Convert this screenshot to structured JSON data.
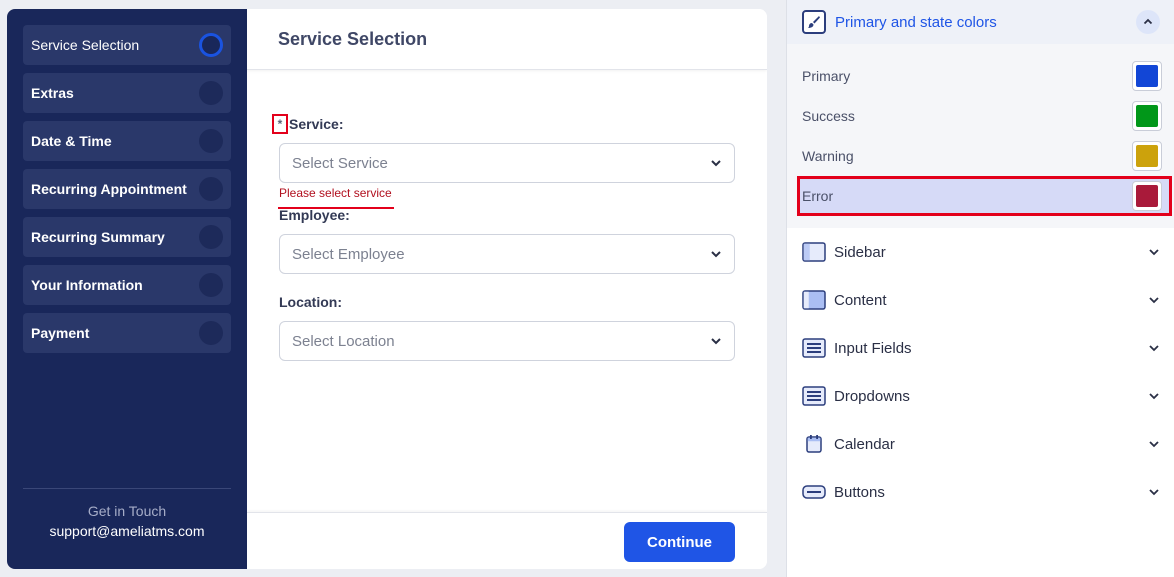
{
  "booking": {
    "steps": [
      {
        "label": "Service Selection",
        "active": true
      },
      {
        "label": "Extras",
        "active": false
      },
      {
        "label": "Date & Time",
        "active": false
      },
      {
        "label": "Recurring Appointment",
        "active": false
      },
      {
        "label": "Recurring Summary",
        "active": false
      },
      {
        "label": "Your Information",
        "active": false
      },
      {
        "label": "Payment",
        "active": false
      }
    ],
    "footer": {
      "title": "Get in Touch",
      "email": "support@ameliatms.com"
    },
    "title": "Service Selection",
    "required_mark": "*",
    "service": {
      "label": "Service:",
      "placeholder": "Select Service",
      "error": "Please select service"
    },
    "employee": {
      "label": "Employee:",
      "placeholder": "Select Employee"
    },
    "location": {
      "label": "Location:",
      "placeholder": "Select Location"
    },
    "continue_label": "Continue"
  },
  "panel": {
    "header": {
      "title": "Primary and state colors",
      "icon": "paintbrush-icon",
      "expanded": true
    },
    "colors": [
      {
        "label": "Primary",
        "value": "#1246d6"
      },
      {
        "label": "Success",
        "value": "#019719"
      },
      {
        "label": "Warning",
        "value": "#ccA20c"
      },
      {
        "label": "Error",
        "value": "#a91a3a",
        "selected": true
      }
    ],
    "sections": [
      {
        "label": "Sidebar",
        "icon": "sidebar-icon"
      },
      {
        "label": "Content",
        "icon": "content-icon"
      },
      {
        "label": "Input Fields",
        "icon": "input-fields-icon"
      },
      {
        "label": "Dropdowns",
        "icon": "dropdowns-icon"
      },
      {
        "label": "Calendar",
        "icon": "calendar-icon"
      },
      {
        "label": "Buttons",
        "icon": "buttons-icon"
      }
    ]
  },
  "colors": {
    "sidebar_bg": "#19275a",
    "accent": "#1f55e6",
    "error": "#b1101f",
    "highlight_outline": "#e3001b"
  }
}
